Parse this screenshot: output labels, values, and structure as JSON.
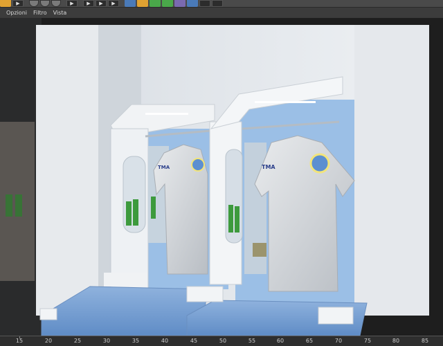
{
  "menu": {
    "items": [
      "Opzioni",
      "Filtro",
      "Vista"
    ]
  },
  "toolbar": {
    "buttons": [
      {
        "icon": "render-icon",
        "color": "#e0a232"
      },
      {
        "icon": "play-icon"
      },
      {
        "icon": "view-circle-icon"
      },
      {
        "icon": "view-circle-icon"
      },
      {
        "icon": "view-circle-icon"
      },
      {
        "icon": "play-icon"
      },
      {
        "icon": "play-icon"
      },
      {
        "icon": "play-icon"
      },
      {
        "icon": "cube-icon",
        "color": "#4a7ab8"
      },
      {
        "icon": "spline-icon",
        "color": "#e0a232"
      },
      {
        "icon": "generator-icon",
        "color": "#4aa84a"
      },
      {
        "icon": "deformer-icon",
        "color": "#4aa84a"
      },
      {
        "icon": "scene-icon",
        "color": "#7a6ab0"
      },
      {
        "icon": "floor-icon",
        "color": "#4a7ab8"
      },
      {
        "icon": "camera-icon"
      },
      {
        "icon": "light-icon"
      }
    ]
  },
  "timeline": {
    "ticks": [
      "15",
      "20",
      "25",
      "30",
      "35",
      "40",
      "45",
      "50",
      "55",
      "60",
      "65",
      "70",
      "75",
      "80",
      "85"
    ]
  }
}
